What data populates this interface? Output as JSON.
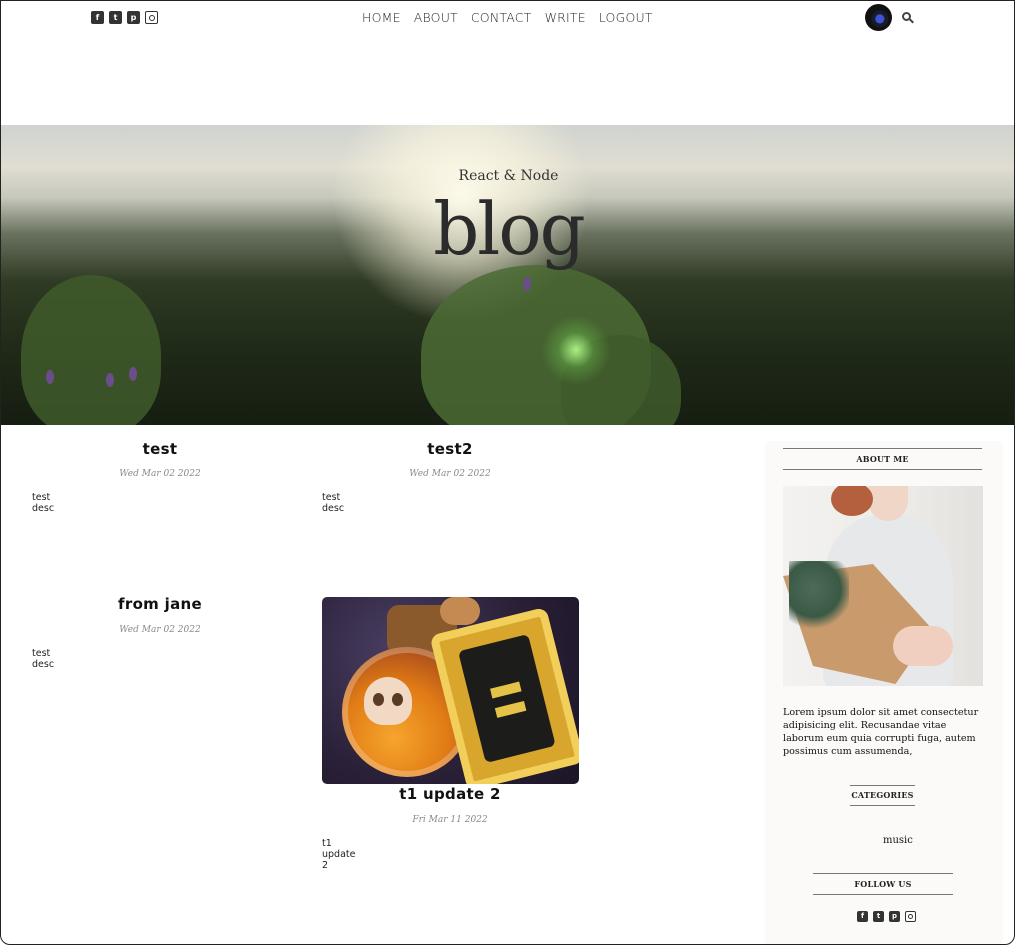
{
  "header": {
    "social_icons": [
      "facebook-square-icon",
      "twitter-square-icon",
      "pinterest-square-icon",
      "instagram-icon"
    ],
    "nav": [
      "HOME",
      "ABOUT",
      "CONTACT",
      "WRITE",
      "LOGOUT"
    ],
    "icons": [
      "avatar",
      "search-icon"
    ]
  },
  "hero": {
    "subtitle": "React & Node",
    "title": "blog"
  },
  "posts": [
    {
      "title": "test",
      "date": "Wed Mar 02 2022",
      "desc": "test desc"
    },
    {
      "title": "test2",
      "date": "Wed Mar 02 2022",
      "desc": "test desc"
    },
    {
      "title": "from jane",
      "date": "Wed Mar 02 2022",
      "desc": "test desc"
    },
    {
      "title": "t1 update 2",
      "date": "Fri Mar 11 2022",
      "desc": "t1 update 2"
    }
  ],
  "sidebar": {
    "about_title": "ABOUT ME",
    "about_text": "Lorem ipsum dolor sit amet consectetur adipisicing elit. Recusandae vitae laborum eum quia corrupti fuga, autem possimus cum assumenda,",
    "categories_title": "CATEGORIES",
    "categories": [
      "music"
    ],
    "follow_title": "FOLLOW US"
  }
}
